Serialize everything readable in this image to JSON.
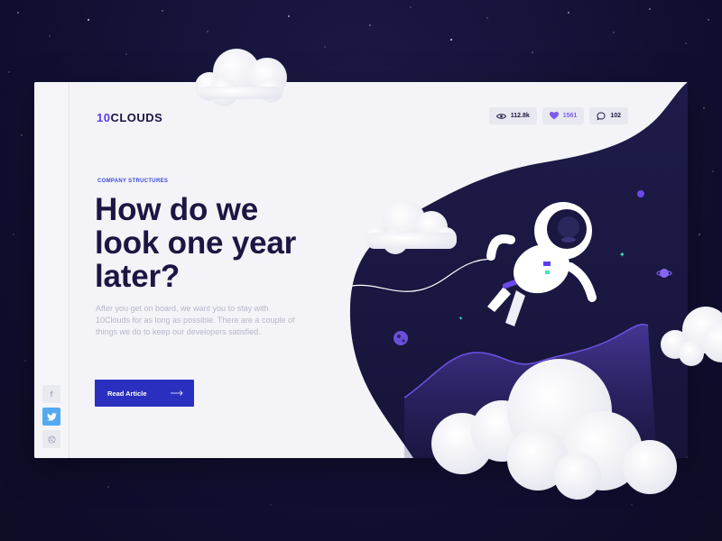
{
  "brand": {
    "logo_mark": "10",
    "logo_text": "CLOUDS",
    "mark_color": "#5a3df2"
  },
  "stats": {
    "views": "112.8k",
    "likes": "1561",
    "comments": "102"
  },
  "article": {
    "eyebrow": "COMPANY STRUCTURES",
    "headline": "How do we look one year later?",
    "lead": "After you get on board, we want you to stay with 10Clouds for as long as possible. There are a couple of things we do to keep our developers satisfied.",
    "cta_label": "Read Article"
  },
  "social": {
    "facebook": "f"
  },
  "icons": [
    "eye-icon",
    "heart-icon",
    "comment-icon",
    "arrow-right-icon",
    "facebook-icon",
    "twitter-icon",
    "dribbble-icon"
  ],
  "colors": {
    "primary": "#2b2fbf",
    "text": "#1d1542",
    "accent": "#7b5bf0",
    "space": "#1a1741",
    "twitter": "#54aaf0"
  }
}
